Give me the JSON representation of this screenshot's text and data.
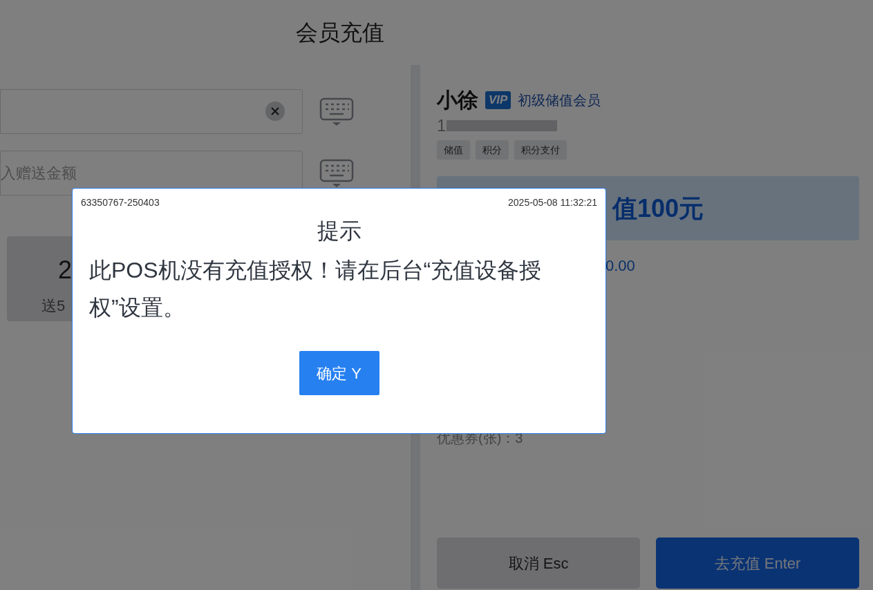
{
  "header": {
    "title": "会员充值"
  },
  "left_panel": {
    "fields": [
      {
        "clearable": true
      },
      {
        "placeholder": "入赠送金额",
        "clearable": false
      }
    ],
    "card": {
      "amount": "2",
      "bonus": "送5"
    }
  },
  "member": {
    "name": "小徐",
    "badge": "VIP",
    "level": "初级储值会员",
    "phone": "1",
    "tags": [
      "储值",
      "积分",
      "积分支付"
    ],
    "banner": "值100元",
    "balance": "0.00",
    "coupons": "优惠券(张)：3"
  },
  "buttons": [
    {
      "label": "取消 Esc",
      "kind": "secondary"
    },
    {
      "label": "去充值 Enter",
      "kind": "primary"
    }
  ],
  "dialog": {
    "code": "63350767-250403",
    "time": "2025-05-08 11:32:21",
    "title": "提示",
    "message": "此POS机没有充值授权！请在后台“充值设备授权”设置。",
    "button": "确定 Y"
  }
}
